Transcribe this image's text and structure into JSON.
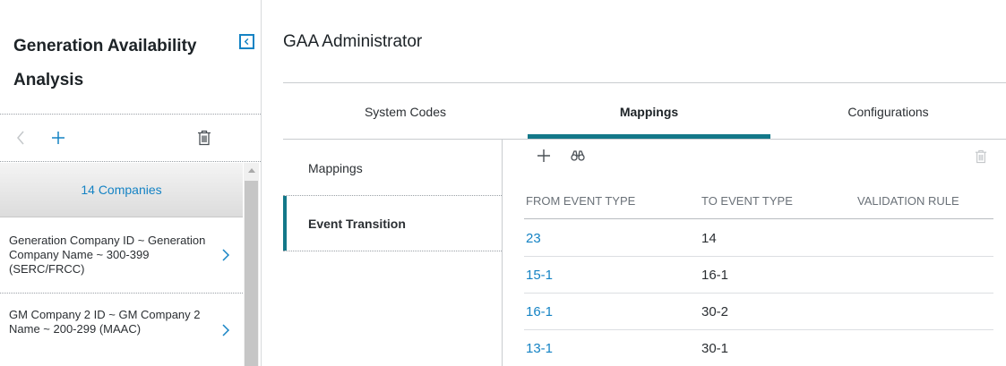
{
  "sidebar": {
    "title": "Generation Availability Analysis",
    "list_header": "14 Companies",
    "items": [
      {
        "label": "Generation Company ID ~ Generation Company Name ~ 300-399 (SERC/FRCC)"
      },
      {
        "label": "GM Company 2 ID ~ GM Company 2 Name ~ 200-299 (MAAC)"
      }
    ]
  },
  "main": {
    "title": "GAA Administrator",
    "tabs": [
      {
        "label": "System Codes"
      },
      {
        "label": "Mappings"
      },
      {
        "label": "Configurations"
      }
    ],
    "active_tab": "Mappings",
    "sub_nav": [
      {
        "label": "Mappings"
      },
      {
        "label": "Event Transition"
      }
    ],
    "active_sub_nav": "Event Transition",
    "grid": {
      "columns": [
        "FROM EVENT TYPE",
        "TO EVENT TYPE",
        "VALIDATION RULE"
      ],
      "rows": [
        {
          "from": "23",
          "to": "14",
          "rule": ""
        },
        {
          "from": "15-1",
          "to": "16-1",
          "rule": ""
        },
        {
          "from": "16-1",
          "to": "30-2",
          "rule": ""
        },
        {
          "from": "13-1",
          "to": "30-1",
          "rule": ""
        }
      ]
    }
  },
  "icons": {
    "collapse": "collapse-left-icon",
    "back": "chevron-left-icon",
    "add": "plus-icon",
    "delete": "trash-icon",
    "search": "binoculars-icon",
    "row_chevron": "chevron-right-icon"
  },
  "colors": {
    "accent": "#137889",
    "link": "#1583c4",
    "disabled_icon": "#c4c7ca"
  }
}
